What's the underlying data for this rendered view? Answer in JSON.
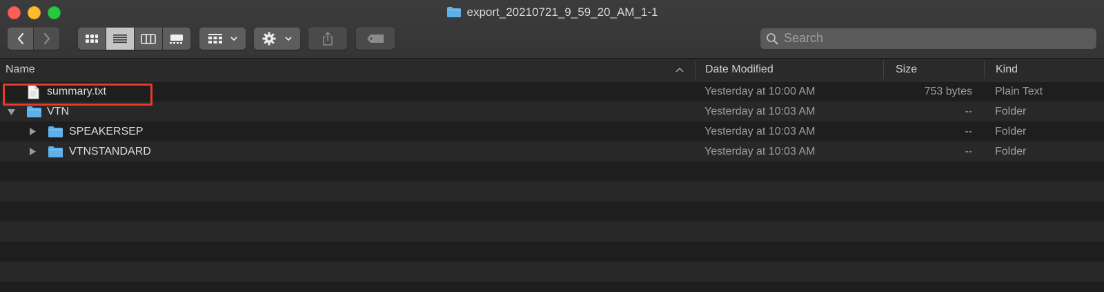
{
  "window": {
    "title": "export_20210721_9_59_20_AM_1-1"
  },
  "toolbar": {
    "back_icon": "chevron-left-icon",
    "forward_icon": "chevron-right-icon",
    "view_modes": [
      "icon-view",
      "list-view",
      "column-view",
      "gallery-view"
    ],
    "selected_view": "list-view",
    "group_icon": "group-grid-icon",
    "action_icon": "gear-icon",
    "share_icon": "share-icon",
    "tag_icon": "tag-icon"
  },
  "search": {
    "placeholder": "Search",
    "value": ""
  },
  "columns": {
    "name": "Name",
    "date": "Date Modified",
    "size": "Size",
    "kind": "Kind",
    "sort_icon": "chevron-up-icon"
  },
  "rows": [
    {
      "name": "summary.txt",
      "date": "Yesterday at 10:00 AM",
      "size": "753 bytes",
      "kind": "Plain Text",
      "type": "file",
      "level": 0,
      "expandable": false
    },
    {
      "name": "VTN",
      "date": "Yesterday at 10:03 AM",
      "size": "--",
      "kind": "Folder",
      "type": "folder",
      "level": 0,
      "expanded": true
    },
    {
      "name": "SPEAKERSEP",
      "date": "Yesterday at 10:03 AM",
      "size": "--",
      "kind": "Folder",
      "type": "folder",
      "level": 1,
      "expanded": false
    },
    {
      "name": "VTNSTANDARD",
      "date": "Yesterday at 10:03 AM",
      "size": "--",
      "kind": "Folder",
      "type": "folder",
      "level": 1,
      "expanded": false
    }
  ],
  "colors": {
    "folder": "#5fb0e8",
    "highlight": "#e8392a",
    "background": "#1e1e1e"
  }
}
